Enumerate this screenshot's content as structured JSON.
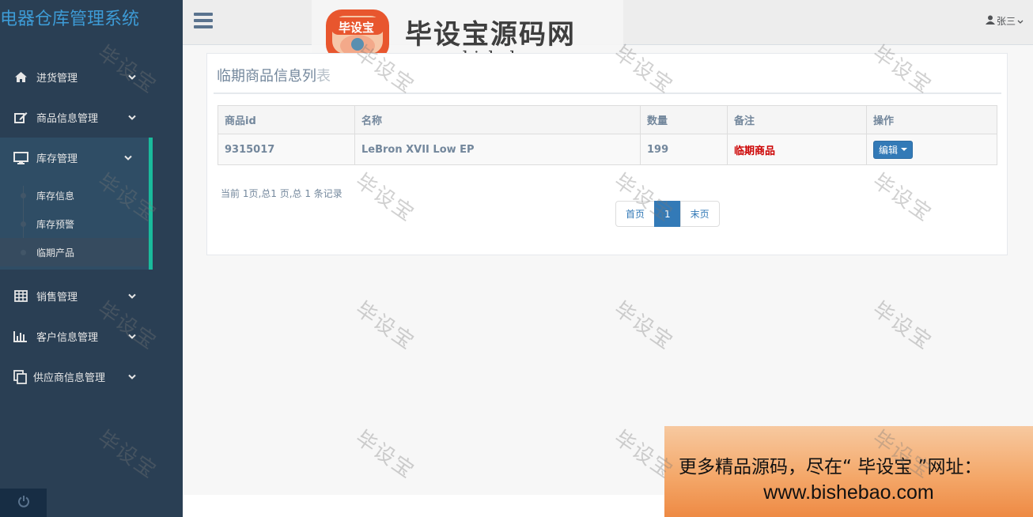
{
  "app": {
    "title": "电器仓库管理系统"
  },
  "sidebar": {
    "items": [
      {
        "label": "进货管理",
        "icon": "home-icon"
      },
      {
        "label": "商品信息管理",
        "icon": "edit-icon"
      },
      {
        "label": "库存管理",
        "icon": "desktop-icon",
        "expanded": true,
        "children": [
          {
            "label": "库存信息"
          },
          {
            "label": "库存预警"
          },
          {
            "label": "临期产品",
            "current": true
          }
        ]
      },
      {
        "label": "销售管理",
        "icon": "table-icon"
      },
      {
        "label": "客户信息管理",
        "icon": "bar-chart-icon"
      },
      {
        "label": "供应商信息管理",
        "icon": "copy-icon"
      }
    ]
  },
  "topnav": {
    "user": "张三"
  },
  "watermark_top": {
    "logo_text": "毕设宝",
    "title": "毕设宝源码网",
    "url": "www.bishebao.com"
  },
  "panel": {
    "title_main": "临期商品信息列",
    "title_fade": "表",
    "table": {
      "headers": [
        "商品id",
        "名称",
        "数量",
        "备注",
        "操作"
      ],
      "rows": [
        {
          "id": "9315017",
          "name": "LeBron XVII Low EP",
          "qty": "199",
          "remark": "临期商品",
          "action": "编辑"
        }
      ]
    },
    "page_info": "当前 1页,总1 页,总 1 条记录",
    "pager": {
      "first": "首页",
      "current": "1",
      "last": "末页"
    }
  },
  "banner": {
    "line1": "更多精品源码，尽在“ 毕设宝 ”网址：",
    "line2": "www.bishebao.com"
  },
  "watermark_text": "毕设宝",
  "colors": {
    "sidebar_bg": "#2a3f54",
    "accent": "#1abb9c",
    "primary": "#337ab7",
    "danger": "#cc0000"
  }
}
